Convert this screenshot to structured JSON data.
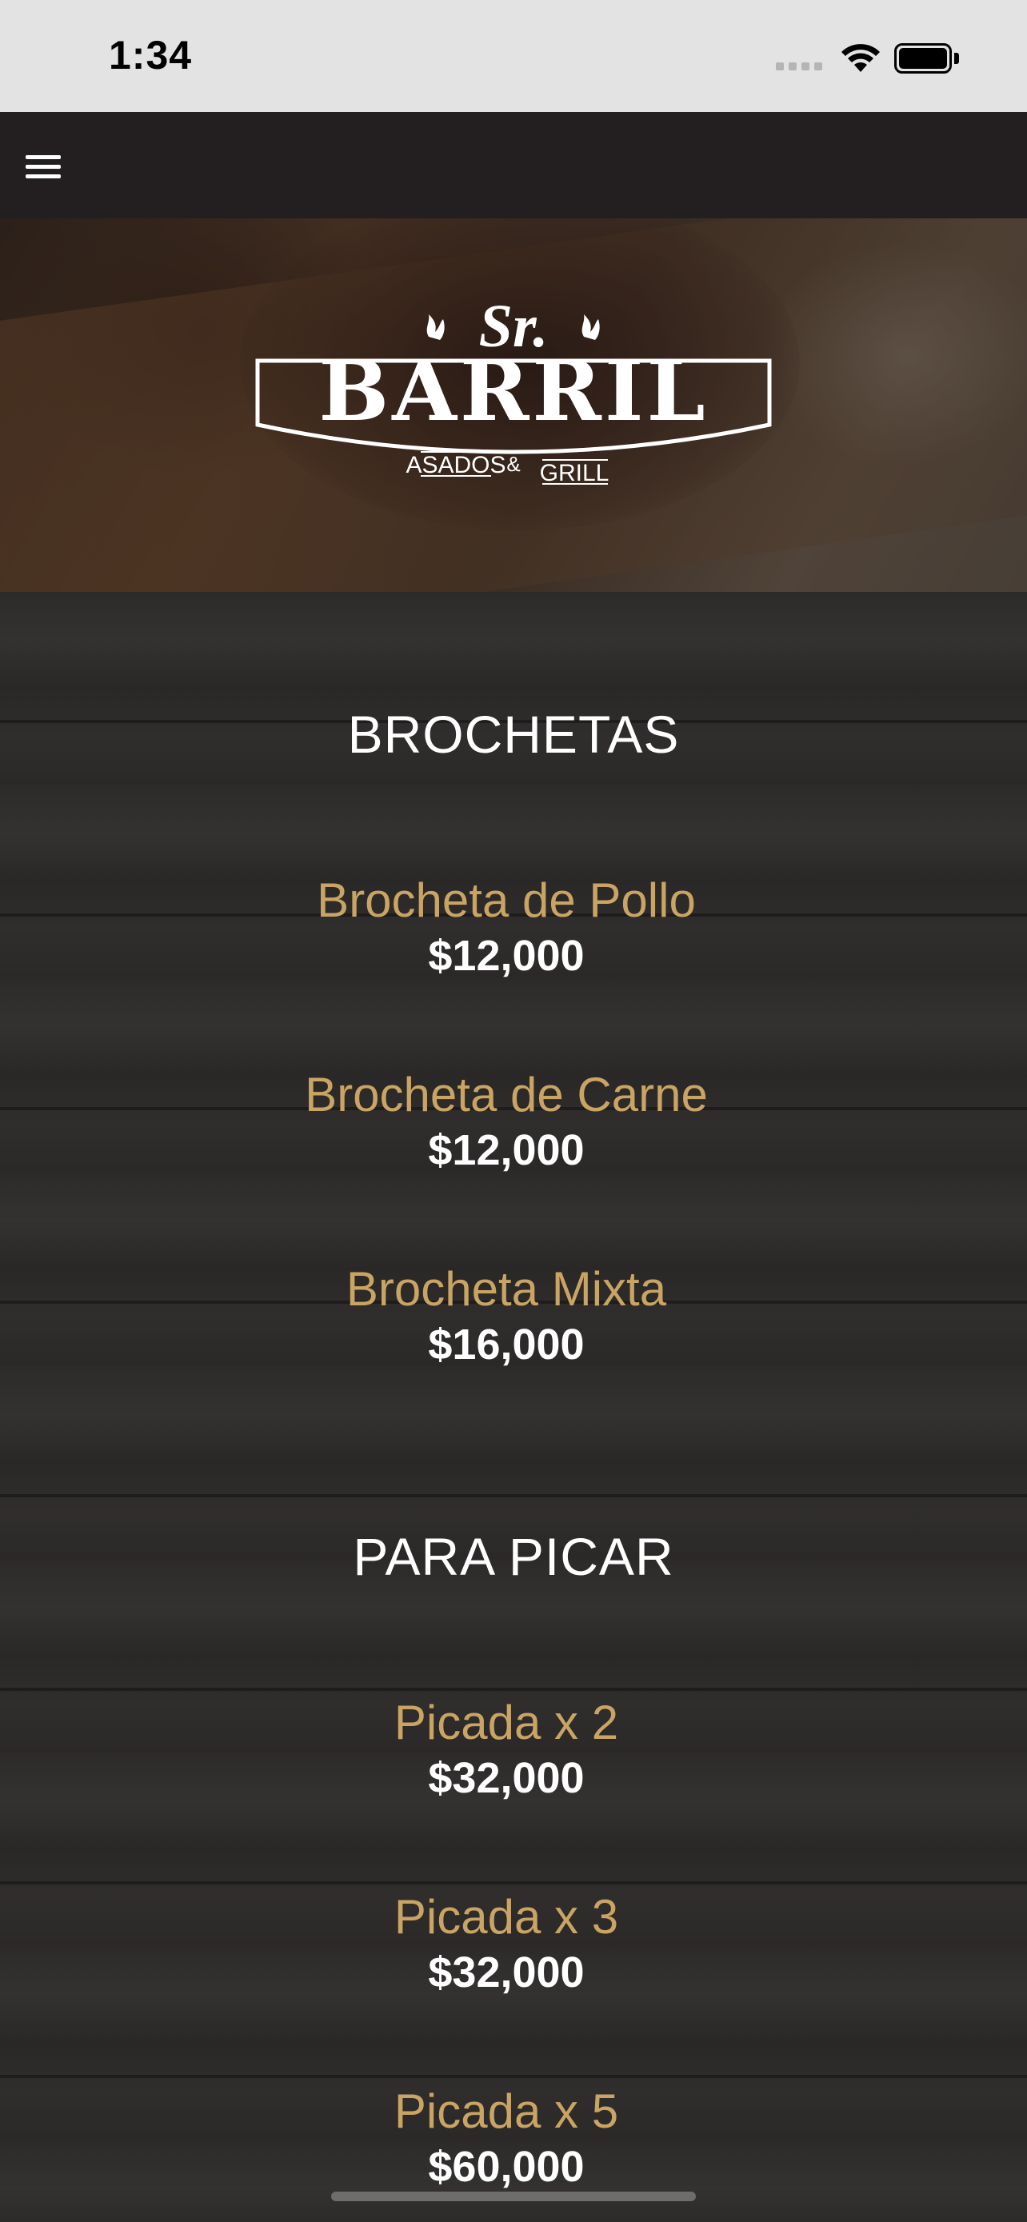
{
  "status": {
    "time": "1:34"
  },
  "nav": {
    "menu_icon": "hamburger-menu-icon"
  },
  "brand": {
    "top": "Sr.",
    "name": "BARRIL",
    "left_tag": "ASADOS",
    "amp": "&",
    "right_tag": "GRILL"
  },
  "sections": [
    {
      "title": "BROCHETAS",
      "items": [
        {
          "name": "Brocheta de Pollo",
          "price": "$12,000"
        },
        {
          "name": "Brocheta de Carne",
          "price": "$12,000"
        },
        {
          "name": "Brocheta Mixta",
          "price": "$16,000"
        }
      ]
    },
    {
      "title": "PARA PICAR",
      "items": [
        {
          "name": "Picada x 2",
          "price": "$32,000"
        },
        {
          "name": "Picada x 3",
          "price": "$32,000"
        },
        {
          "name": "Picada x 5",
          "price": "$60,000"
        }
      ]
    }
  ],
  "colors": {
    "item_name": "#c9a463",
    "price": "#ffffff",
    "nav_bg": "#231f20"
  }
}
